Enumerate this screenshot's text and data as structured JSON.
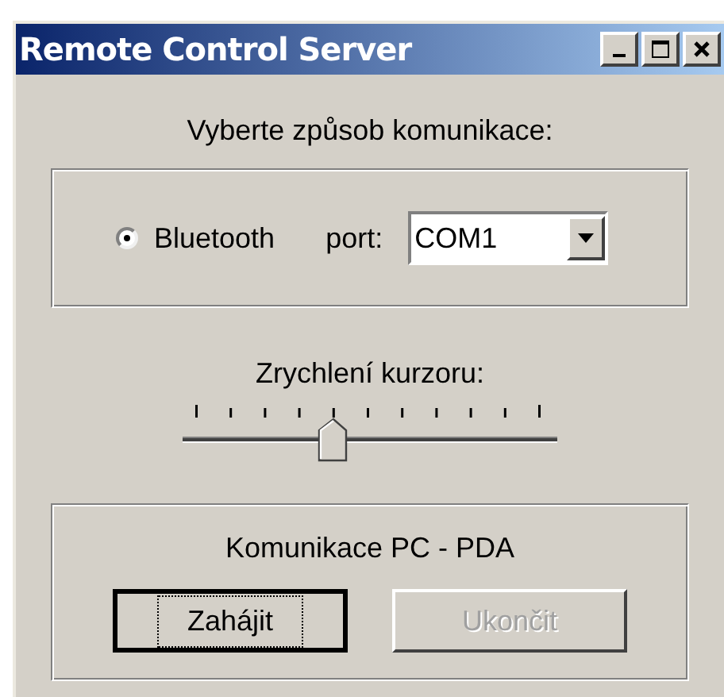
{
  "window": {
    "title": "Remote Control Server",
    "controls": [
      {
        "kind": "minimize"
      },
      {
        "kind": "maximize"
      },
      {
        "kind": "close"
      }
    ]
  },
  "prompt": "Vyberte způsob komunikace:",
  "connection": {
    "radio": {
      "label": "Bluetooth",
      "selected": true
    },
    "port_label": "port:",
    "port": {
      "value": "COM1"
    }
  },
  "speed": {
    "label": "Zrychlení kurzoru:",
    "level": 0.4
  },
  "session": {
    "title": "Komunikace PC - PDA",
    "buttons": [
      {
        "label": "Zahájit",
        "disabled": false,
        "focused": true
      },
      {
        "label": "Ukončit",
        "disabled": true,
        "focused": false
      }
    ]
  }
}
